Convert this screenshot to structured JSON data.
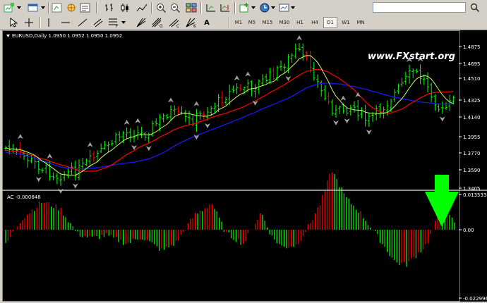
{
  "toolbar": {
    "timeframes": [
      "M1",
      "M5",
      "M15",
      "M30",
      "H1",
      "H4",
      "D1",
      "W1",
      "MN"
    ],
    "active_timeframe": "D1",
    "text_tool": "A"
  },
  "chart": {
    "header": "EURUSD,Daily  1.0950 1.0952 1.0950 1.0952",
    "watermark": "www.FXstart.org",
    "price_ticks": [
      "1.4875",
      "1.4695",
      "1.4510",
      "1.4325",
      "1.4140",
      "1.3955",
      "1.3770",
      "1.3590",
      "1.3405"
    ],
    "colors": {
      "bull": "#00ff00",
      "bear": "#ff0000",
      "ma_fast": "#c0ff60",
      "ma_mid": "#ff0000",
      "ma_slow": "#1a1aff",
      "arrow": "#00ff00",
      "fractal": "#a0a0a0"
    }
  },
  "indicator": {
    "header": "AC -0.000648",
    "ticks": [
      "0.013533",
      "0.00",
      "-0.022996"
    ]
  },
  "chart_data": {
    "type": "candlestick",
    "price_range": [
      1.3405,
      1.4875
    ],
    "indicator_range": [
      -0.022996,
      0.013533
    ]
  }
}
